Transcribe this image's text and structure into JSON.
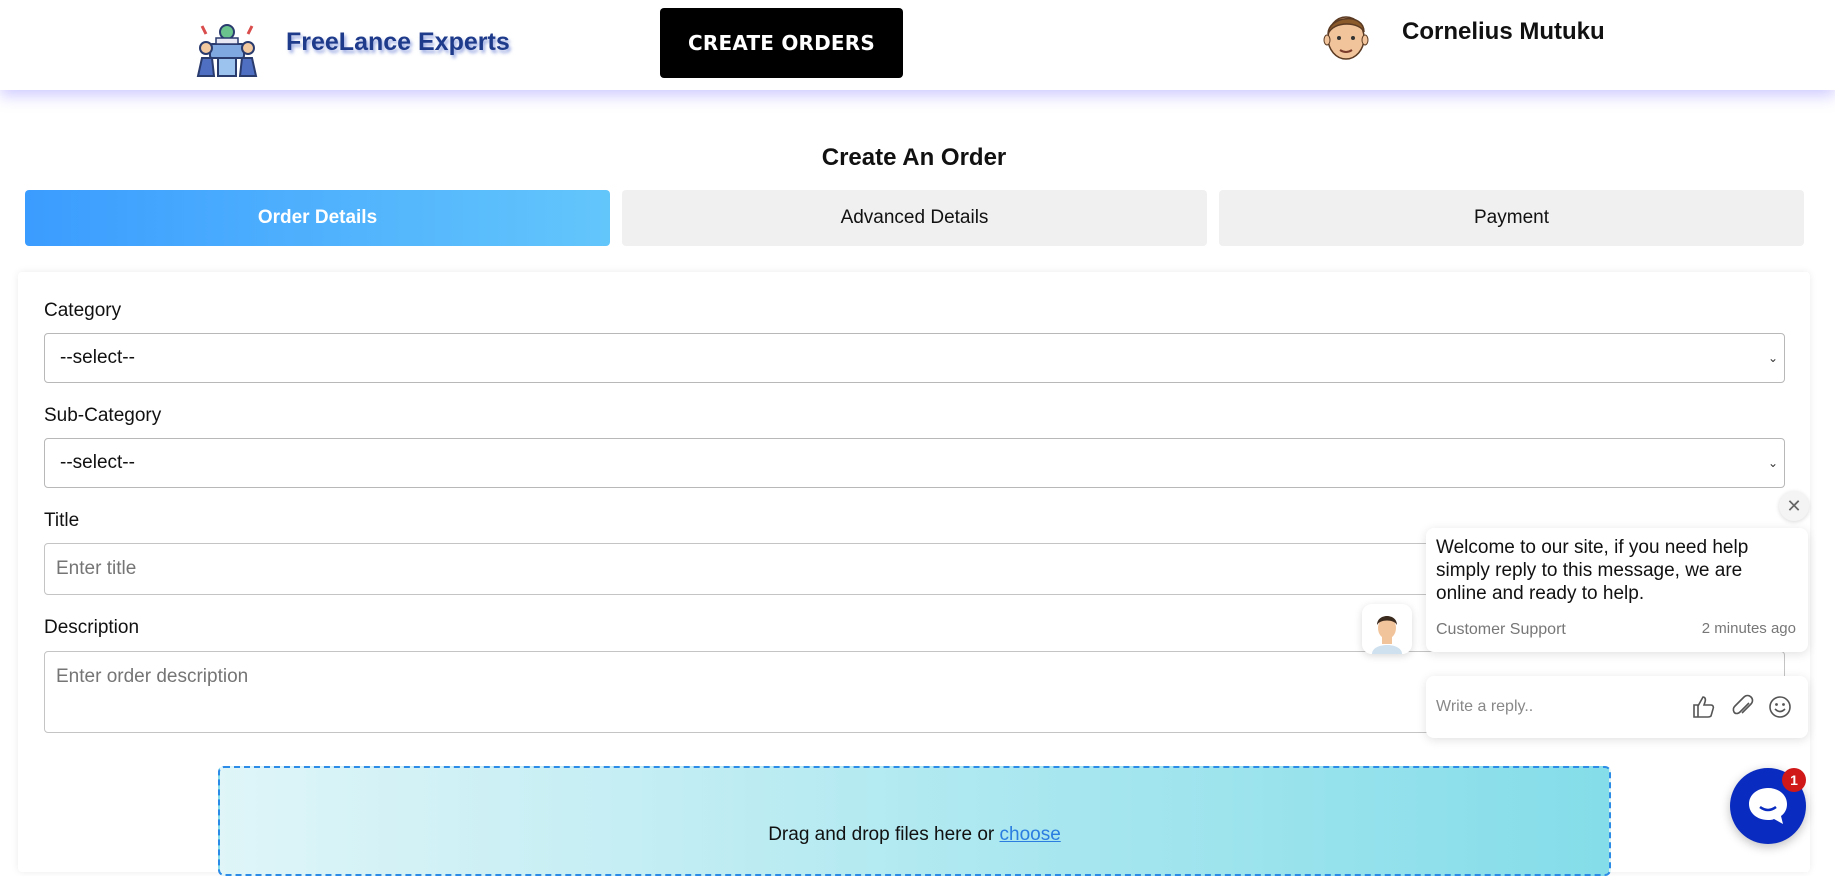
{
  "header": {
    "brand": "FreeLance Experts",
    "create_button": "CREATE ORDERS",
    "username": "Cornelius Mutuku"
  },
  "page_title": "Create An Order",
  "tabs": [
    {
      "label": "Order Details",
      "active": true
    },
    {
      "label": "Advanced Details",
      "active": false
    },
    {
      "label": "Payment",
      "active": false
    }
  ],
  "form": {
    "category": {
      "label": "Category",
      "value": "--select--"
    },
    "subcategory": {
      "label": "Sub-Category",
      "value": "--select--"
    },
    "title": {
      "label": "Title",
      "placeholder": "Enter title"
    },
    "description": {
      "label": "Description",
      "placeholder": "Enter order description"
    },
    "dropzone": {
      "text": "Drag and drop files here or",
      "link": "choose"
    }
  },
  "chat": {
    "message": "Welcome to our site, if you need help simply reply to this message, we are online and ready to help.",
    "sender": "Customer Support",
    "time": "2 minutes ago",
    "reply_placeholder": "Write a reply..",
    "unread_count": "1"
  },
  "colors": {
    "accent_gradient_start": "#3b9cff",
    "accent_gradient_end": "#63c6fb",
    "brand_text": "#1e3a8a",
    "chat_launcher": "#0a2bbf",
    "badge": "#d01818"
  },
  "icons": [
    "team-logo-icon",
    "user-avatar-icon",
    "chevron-down-icon",
    "close-icon",
    "support-agent-icon",
    "thumbs-up-icon",
    "paperclip-icon",
    "smiley-icon",
    "chat-bubble-icon"
  ]
}
